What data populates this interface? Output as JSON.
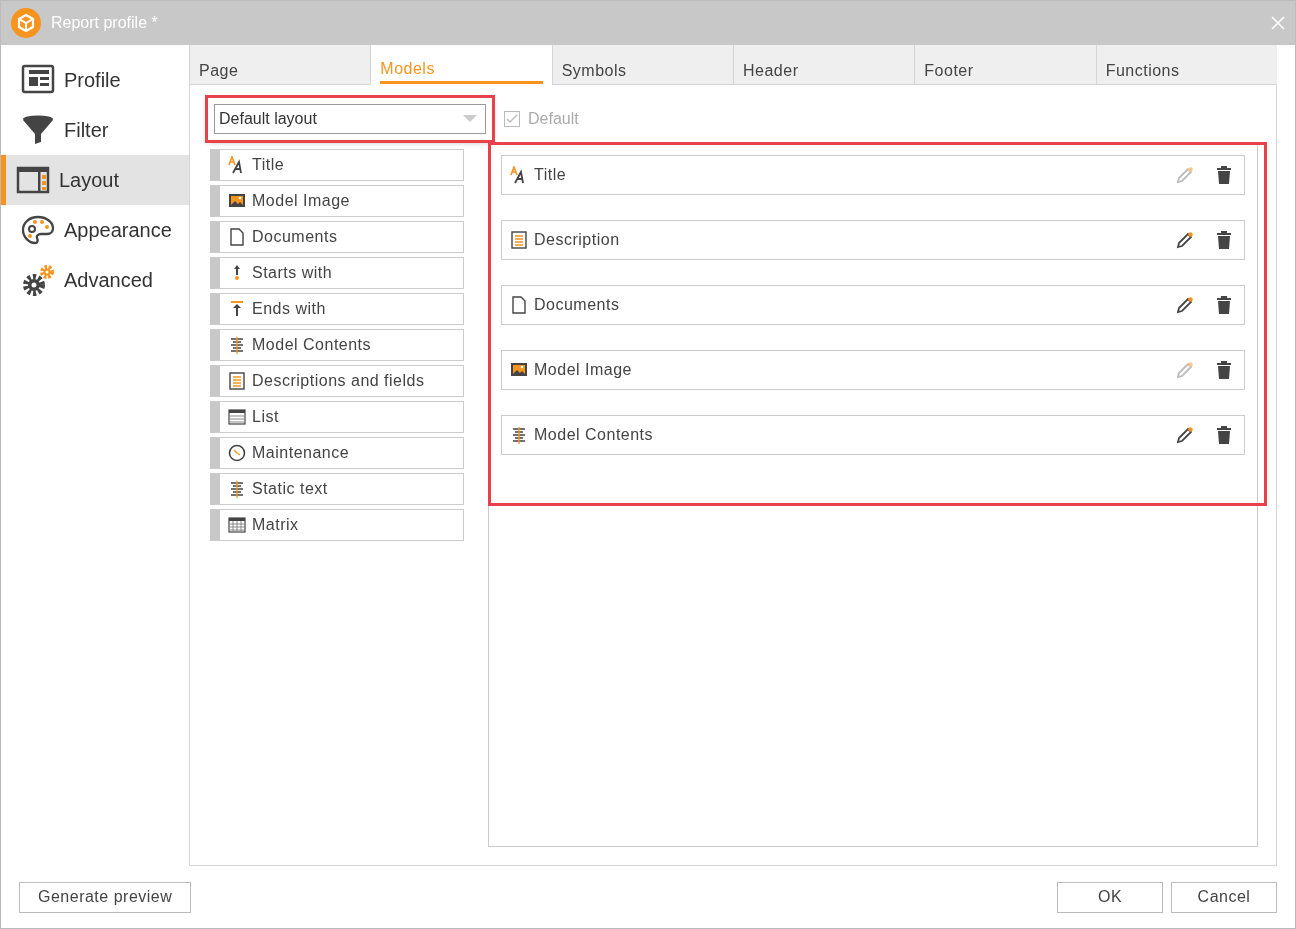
{
  "window": {
    "title": "Report profile *"
  },
  "sidebar": {
    "items": [
      {
        "label": "Profile",
        "kind": "profile",
        "selected": false
      },
      {
        "label": "Filter",
        "kind": "filter",
        "selected": false
      },
      {
        "label": "Layout",
        "kind": "layout",
        "selected": true
      },
      {
        "label": "Appearance",
        "kind": "palette",
        "selected": false
      },
      {
        "label": "Advanced",
        "kind": "gears",
        "selected": false
      }
    ]
  },
  "tabs": [
    {
      "label": "Page",
      "selected": false
    },
    {
      "label": "Models",
      "selected": true
    },
    {
      "label": "Symbols",
      "selected": false
    },
    {
      "label": "Header",
      "selected": false
    },
    {
      "label": "Footer",
      "selected": false
    },
    {
      "label": "Functions",
      "selected": false
    }
  ],
  "layout_select": {
    "value": "Default layout",
    "highlighted": true
  },
  "default_checkbox": {
    "label": "Default",
    "checked": true,
    "disabled": true
  },
  "available_elements": [
    {
      "label": "Title",
      "kind": "title"
    },
    {
      "label": "Model Image",
      "kind": "image"
    },
    {
      "label": "Documents",
      "kind": "document"
    },
    {
      "label": "Starts with",
      "kind": "start"
    },
    {
      "label": "Ends with",
      "kind": "end"
    },
    {
      "label": "Model Contents",
      "kind": "contents"
    },
    {
      "label": "Descriptions and fields",
      "kind": "description"
    },
    {
      "label": "List",
      "kind": "list"
    },
    {
      "label": "Maintenance",
      "kind": "clock"
    },
    {
      "label": "Static text",
      "kind": "contents"
    },
    {
      "label": "Matrix",
      "kind": "matrix"
    }
  ],
  "layout_elements": {
    "highlighted": true,
    "items": [
      {
        "label": "Title",
        "kind": "title",
        "edit_enabled": false
      },
      {
        "label": "Description",
        "kind": "description",
        "edit_enabled": true
      },
      {
        "label": "Documents",
        "kind": "document",
        "edit_enabled": true
      },
      {
        "label": "Model Image",
        "kind": "image",
        "edit_enabled": false
      },
      {
        "label": "Model Contents",
        "kind": "contents",
        "edit_enabled": true
      }
    ]
  },
  "buttons": {
    "preview": "Generate preview",
    "ok": "OK",
    "cancel": "Cancel"
  }
}
